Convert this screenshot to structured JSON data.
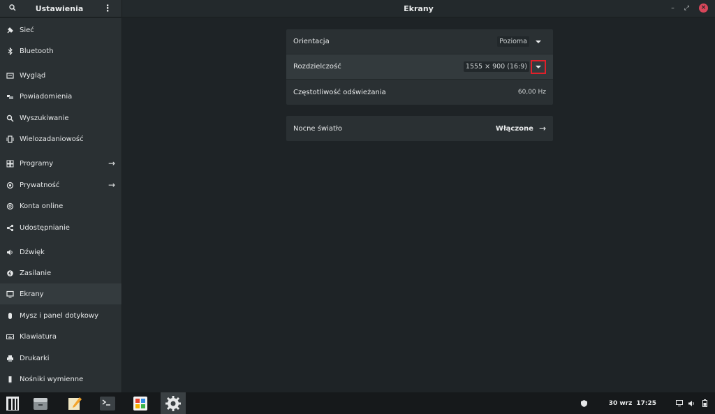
{
  "sidebar": {
    "title": "Ustawienia",
    "items": [
      {
        "label": "Sieć",
        "icon": "network-icon"
      },
      {
        "label": "Bluetooth",
        "icon": "bluetooth-icon"
      },
      {
        "label": "Wygląd",
        "icon": "appearance-icon"
      },
      {
        "label": "Powiadomienia",
        "icon": "notifications-icon"
      },
      {
        "label": "Wyszukiwanie",
        "icon": "search-icon"
      },
      {
        "label": "Wielozadaniowość",
        "icon": "multitasking-icon"
      },
      {
        "label": "Programy",
        "icon": "apps-grid-icon"
      },
      {
        "label": "Prywatność",
        "icon": "privacy-icon"
      },
      {
        "label": "Konta online",
        "icon": "at-sign-icon"
      },
      {
        "label": "Udostępnianie",
        "icon": "share-icon"
      },
      {
        "label": "Dźwięk",
        "icon": "speaker-icon"
      },
      {
        "label": "Zasilanie",
        "icon": "power-icon"
      },
      {
        "label": "Ekrany",
        "icon": "display-icon"
      },
      {
        "label": "Mysz i panel dotykowy",
        "icon": "mouse-icon"
      },
      {
        "label": "Klawiatura",
        "icon": "keyboard-icon"
      },
      {
        "label": "Drukarki",
        "icon": "printer-icon"
      },
      {
        "label": "Nośniki wymienne",
        "icon": "removable-media-icon"
      }
    ]
  },
  "header": {
    "title": "Ekrany"
  },
  "display": {
    "orientation_label": "Orientacja",
    "orientation_value": "Pozioma",
    "resolution_label": "Rozdzielczość",
    "resolution_value": "1555 × 900 (16:9)",
    "refresh_label": "Częstotliwość odświeżania",
    "refresh_value": "60,00 Hz",
    "night_light_label": "Nocne światło",
    "night_light_value": "Włączone"
  },
  "taskbar": {
    "apps": [
      "activities-icon",
      "files-icon",
      "text-editor-icon",
      "terminal-icon",
      "software-icon",
      "settings-icon"
    ],
    "date": "30 wrz",
    "time": "17:25"
  },
  "colors": {
    "background": "#1e2326",
    "sidebar": "#2a3033",
    "marker": "#e0202a",
    "close": "#d8465a"
  }
}
